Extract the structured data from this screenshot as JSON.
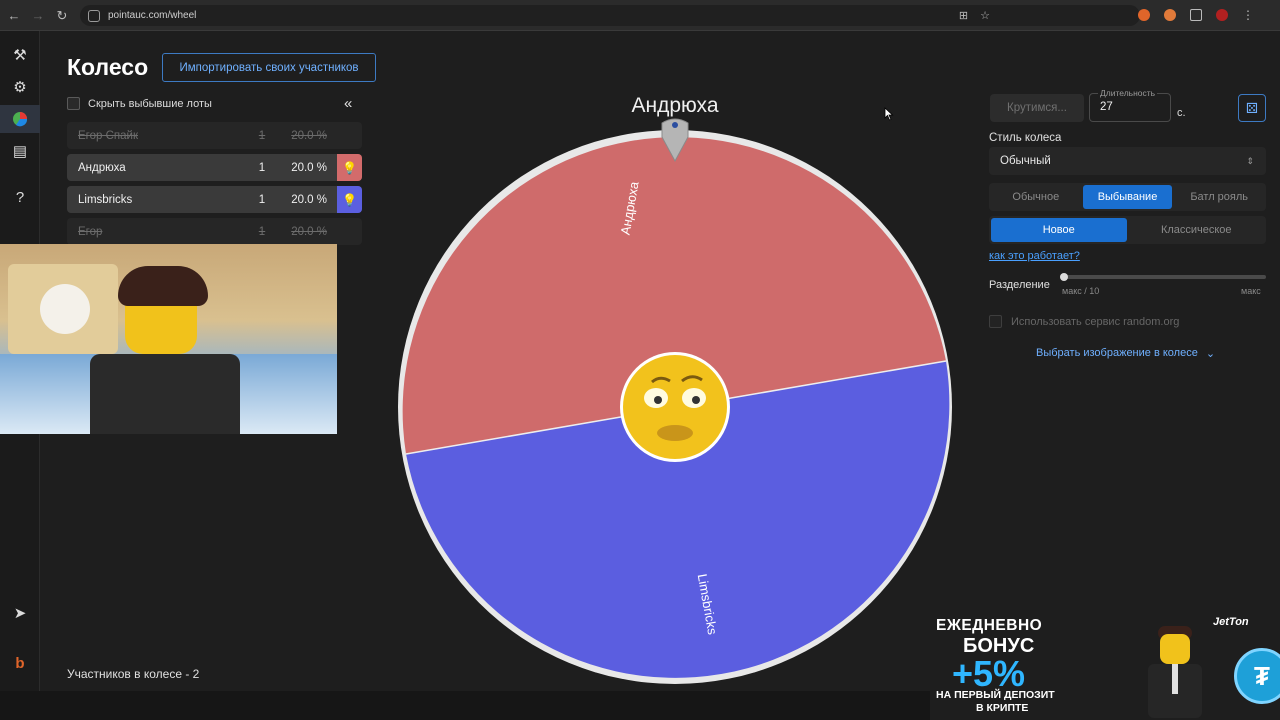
{
  "browser": {
    "url": "pointauc.com/wheel"
  },
  "rail": {
    "icons": [
      "gavel-icon",
      "gear-icon",
      "wheel-chart-icon",
      "clipboard-icon",
      "help-icon",
      "telegram-icon",
      "brand-b-icon"
    ]
  },
  "header": {
    "title": "Колесо",
    "import_label": "Импортировать своих участников"
  },
  "lots_panel": {
    "hide_label": "Скрыть выбывшие лоты",
    "collapse_glyph": "«",
    "items": [
      {
        "name": "Егор Спайк",
        "amount": "1",
        "percent": "20.0 %",
        "state": "out",
        "color": ""
      },
      {
        "name": "Андрюха",
        "amount": "1",
        "percent": "20.0 %",
        "state": "active",
        "color": "#d36b6b"
      },
      {
        "name": "Limsbricks",
        "amount": "1",
        "percent": "20.0 %",
        "state": "active",
        "color": "#5b5fe0"
      },
      {
        "name": "Егор",
        "amount": "1",
        "percent": "20.0 %",
        "state": "out",
        "color": ""
      }
    ],
    "count_label": "Участников в колесе - 2"
  },
  "wheel": {
    "winner": "Андрюха",
    "segments": [
      {
        "label": "Андрюха",
        "color": "#cf6b6b"
      },
      {
        "label": "Limsbricks",
        "color": "#5b5ee0"
      }
    ]
  },
  "controls": {
    "spin_label": "Крутимся...",
    "duration_label": "Длительность",
    "duration_value": "27",
    "duration_unit": "с.",
    "style_label": "Стиль колеса",
    "style_value": "Обычный",
    "mode_tabs": [
      "Обычное",
      "Выбывание",
      "Батл рояль"
    ],
    "mode_selected": "Выбывание",
    "variant_tabs": [
      "Новое",
      "Классическое"
    ],
    "variant_selected": "Новое",
    "how_link": "как это работает?",
    "split_label": "Разделение",
    "split_min": "макс / 10",
    "split_max": "макс",
    "random_org_label": "Использовать сервис random.org",
    "image_select_label": "Выбрать изображение в колесе"
  },
  "ad": {
    "line1": "ЕЖЕДНЕВНО",
    "line2": "БОНУС",
    "line3": "+5%",
    "line4": "НА ПЕРВЫЙ ДЕПОЗИТ",
    "line5": "В КРИПТЕ",
    "brand": "JetTon"
  }
}
